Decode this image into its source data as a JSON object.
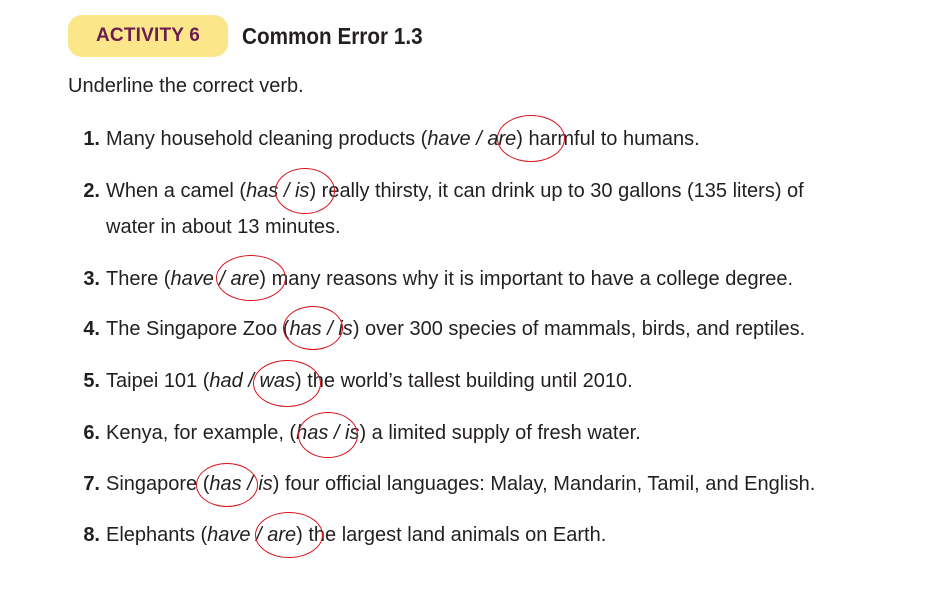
{
  "header": {
    "badge": "ACTIVITY 6",
    "title": "Common Error 1.3"
  },
  "instruction": "Underline the correct verb.",
  "items": [
    {
      "num": "1.",
      "pre": "Many household cleaning products (",
      "opt1": "have",
      "sep": " / ",
      "opt2": "are",
      "post": ") harmful to humans.",
      "circled": "are"
    },
    {
      "num": "2.",
      "pre": "When a camel (",
      "opt1": "has",
      "sep": " / ",
      "opt2": "is",
      "post": ") really thirsty, it can drink up to 30 gallons (135 liters) of",
      "cont": "water in about 13 minutes.",
      "circled": "is"
    },
    {
      "num": "3.",
      "pre": "There (",
      "opt1": "have",
      "sep": " / ",
      "opt2": "are",
      "post": ") many reasons why it is important to have a college degree.",
      "circled": "are"
    },
    {
      "num": "4.",
      "pre": "The Singapore Zoo (",
      "opt1": "has",
      "sep": " / ",
      "opt2": "is",
      "post": ") over 300 species of mammals, birds, and reptiles.",
      "circled": "has"
    },
    {
      "num": "5.",
      "pre": "Taipei 101 (",
      "opt1": "had",
      "sep": " / ",
      "opt2": "was",
      "post": ") the world’s tallest building until 2010.",
      "circled": "was"
    },
    {
      "num": "6.",
      "pre": "Kenya, for example, (",
      "opt1": "has",
      "sep": " / ",
      "opt2": "is",
      "post": ") a limited supply of fresh water.",
      "circled": "has"
    },
    {
      "num": "7.",
      "pre": "Singapore (",
      "opt1": "has",
      "sep": " / ",
      "opt2": "is",
      "post": ") four official languages: Malay, Mandarin, Tamil, and English.",
      "circled": "has"
    },
    {
      "num": "8.",
      "pre": "Elephants (",
      "opt1": "have",
      "sep": " / ",
      "opt2": "are",
      "post": ") the largest land animals on Earth.",
      "circled": "are"
    }
  ],
  "colors": {
    "badge_bg": "#fbe68a",
    "badge_text": "#6b1e4e",
    "circle": "#d7141a",
    "text": "#231f20"
  }
}
